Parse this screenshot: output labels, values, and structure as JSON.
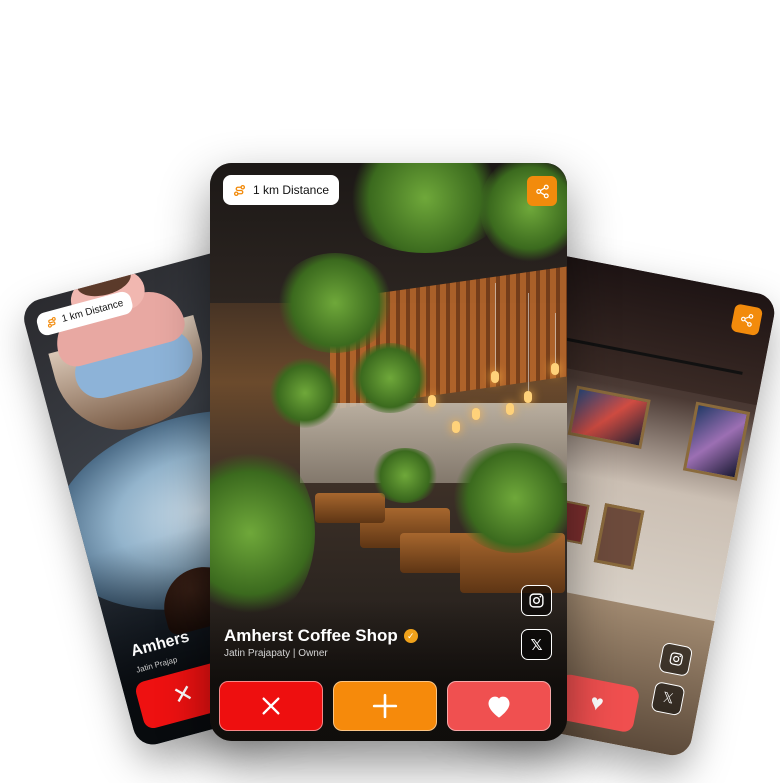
{
  "cards": {
    "left": {
      "distance_label": "1 km Distance",
      "title": "Amhers",
      "subtitle": "Jatin Prajap"
    },
    "center": {
      "distance_label": "1 km Distance",
      "title": "Amherst Coffee Shop",
      "subtitle": "Jatin Prajapaty | Owner",
      "verified": true,
      "social": [
        "instagram-icon",
        "x-icon"
      ],
      "actions": [
        {
          "name": "reject",
          "icon": "close-icon",
          "color": "#ee0f0f"
        },
        {
          "name": "add",
          "icon": "plus-icon",
          "color": "#f68a0b"
        },
        {
          "name": "like",
          "icon": "heart-icon",
          "color": "#f05050"
        }
      ]
    },
    "right": {
      "social": [
        "instagram-icon",
        "x-icon"
      ]
    }
  },
  "colors": {
    "accent": "#f28b0c",
    "reject": "#ee0f0f",
    "like": "#f05050"
  }
}
